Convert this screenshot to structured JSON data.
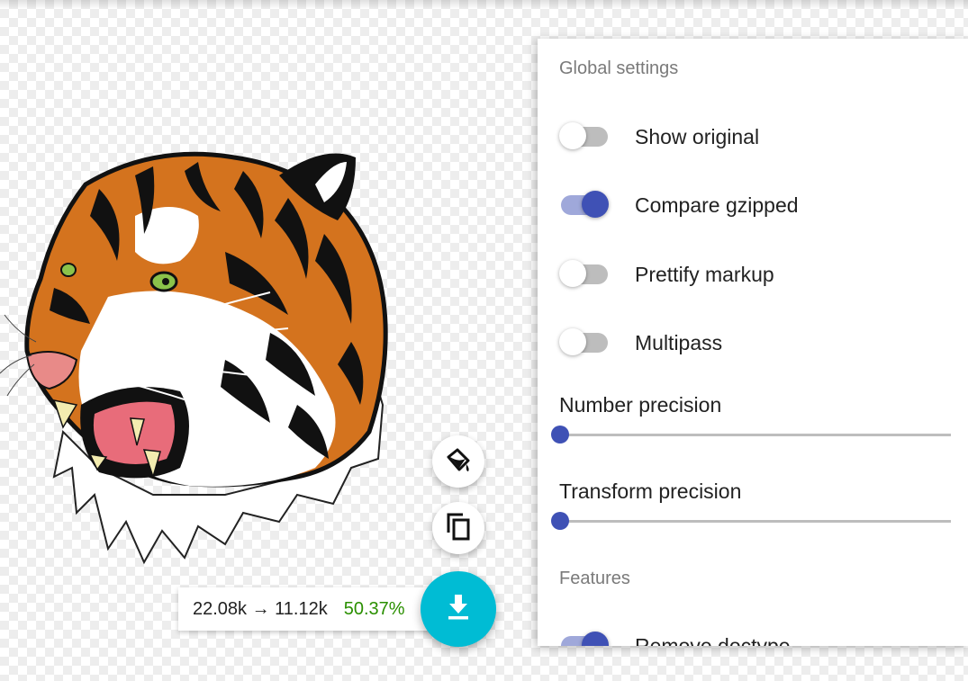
{
  "panel": {
    "global_title": "Global settings",
    "toggles": [
      {
        "label": "Show original",
        "on": false
      },
      {
        "label": "Compare gzipped",
        "on": true
      },
      {
        "label": "Prettify markup",
        "on": false
      },
      {
        "label": "Multipass",
        "on": false
      }
    ],
    "sliders": [
      {
        "label": "Number precision",
        "value": 0
      },
      {
        "label": "Transform precision",
        "value": 0
      }
    ],
    "features_title": "Features",
    "features": [
      {
        "label": "Remove doctype",
        "on": true
      }
    ]
  },
  "results": {
    "sizes": "22.08k → 11.12k",
    "percent": "50.37%"
  },
  "icons": {
    "background": "paint-bucket-icon",
    "copy": "copy-icon",
    "download": "download-icon"
  },
  "colors": {
    "accent": "#3f51b5",
    "accent_track": "#9fa8da",
    "fab": "#00bcd4",
    "savings": "#2a8f00"
  }
}
